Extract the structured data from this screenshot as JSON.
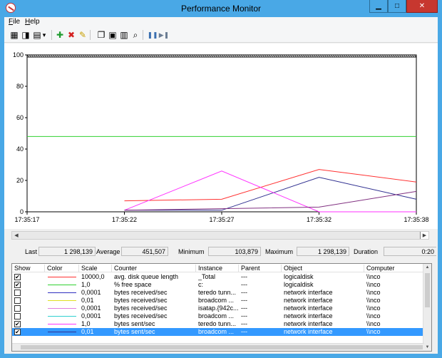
{
  "window": {
    "title": "Performance Monitor"
  },
  "menu": [
    {
      "label": "File",
      "accel": "F",
      "rest": "ile"
    },
    {
      "label": "Help",
      "accel": "H",
      "rest": "elp"
    }
  ],
  "toolbar": [
    {
      "icon": "view-graph-icon",
      "glyph": "▦"
    },
    {
      "icon": "freeze-display-icon",
      "glyph": "◨"
    },
    {
      "icon": "change-graph-type-icon",
      "glyph": "▤"
    },
    {
      "icon": "dropdown-arrow-icon",
      "glyph": "▾"
    },
    {
      "icon": "add-counter-icon",
      "glyph": "✚",
      "color": "#1e9b2e"
    },
    {
      "icon": "delete-counter-icon",
      "glyph": "✖",
      "color": "#d42020"
    },
    {
      "icon": "highlight-icon",
      "glyph": "✎",
      "color": "#c8a000"
    },
    {
      "icon": "copy-properties-icon",
      "glyph": "❐"
    },
    {
      "icon": "paste-counter-list-icon",
      "glyph": "▣"
    },
    {
      "icon": "properties-icon",
      "glyph": "▥"
    },
    {
      "icon": "zoom-icon",
      "glyph": "⌕"
    },
    {
      "icon": "freeze-icon",
      "glyph": "❚❚",
      "color": "#3a6fb0"
    },
    {
      "icon": "update-data-icon",
      "glyph": "▶❚",
      "color": "#6b7d93"
    }
  ],
  "chart_data": {
    "type": "line",
    "title": "",
    "xlabel": "",
    "ylabel": "",
    "x": [
      "17:35:17",
      "17:35:22",
      "17:35:27",
      "17:35:32",
      "17:35:38"
    ],
    "yticks": [
      0,
      20,
      40,
      60,
      80,
      100
    ],
    "ylim": [
      0,
      100
    ],
    "grid": false,
    "legend": "none",
    "series": [
      {
        "color": "#ff3030",
        "points": [
          [
            1,
            7
          ],
          [
            2,
            8
          ],
          [
            3,
            27
          ],
          [
            4,
            19
          ]
        ]
      },
      {
        "color": "#30d030",
        "points": [
          [
            0,
            48
          ],
          [
            4,
            48
          ]
        ]
      },
      {
        "color": "#303090",
        "points": [
          [
            1,
            1
          ],
          [
            2,
            1
          ],
          [
            3,
            22
          ],
          [
            4,
            8
          ]
        ]
      },
      {
        "color": "#ff30ff",
        "points": [
          [
            1,
            1
          ],
          [
            2,
            26
          ],
          [
            3,
            0
          ],
          [
            4,
            0
          ]
        ]
      },
      {
        "color": "#803080",
        "points": [
          [
            1,
            1
          ],
          [
            2,
            2
          ],
          [
            3,
            3
          ],
          [
            4,
            13
          ]
        ]
      }
    ]
  },
  "stats": {
    "last_label": "Last",
    "last_value": "1 298,139",
    "average_label": "Average",
    "average_value": "451,507",
    "minimum_label": "Minimum",
    "minimum_value": "103,879",
    "maximum_label": "Maximum",
    "maximum_value": "1 298,139",
    "duration_label": "Duration",
    "duration_value": "0:20"
  },
  "table": {
    "headers": [
      "Show",
      "Color",
      "Scale",
      "Counter",
      "Instance",
      "Parent",
      "Object",
      "Computer"
    ],
    "rows": [
      {
        "show": true,
        "color": "#ff3030",
        "scale": "10000,0",
        "counter": "avg. disk queue length",
        "instance": "_Total",
        "parent": "---",
        "object": "logicaldisk",
        "computer": "\\\\nco",
        "selected": false
      },
      {
        "show": true,
        "color": "#30d030",
        "scale": "1,0",
        "counter": "% free space",
        "instance": "c:",
        "parent": "---",
        "object": "logicaldisk",
        "computer": "\\\\nco",
        "selected": false
      },
      {
        "show": false,
        "color": "#3030c0",
        "scale": "0,0001",
        "counter": "bytes received/sec",
        "instance": "teredo tunn...",
        "parent": "---",
        "object": "network interface",
        "computer": "\\\\nco",
        "selected": false
      },
      {
        "show": false,
        "color": "#e0e020",
        "scale": "0,01",
        "counter": "bytes received/sec",
        "instance": "broadcom ...",
        "parent": "---",
        "object": "network interface",
        "computer": "\\\\nco",
        "selected": false
      },
      {
        "show": false,
        "color": "#e080e0",
        "scale": "0,0001",
        "counter": "bytes received/sec",
        "instance": "isatap.{942c...",
        "parent": "---",
        "object": "network interface",
        "computer": "\\\\nco",
        "selected": false
      },
      {
        "show": false,
        "color": "#30d0d0",
        "scale": "0,0001",
        "counter": "bytes received/sec",
        "instance": "broadcom ...",
        "parent": "---",
        "object": "network interface",
        "computer": "\\\\nco",
        "selected": false
      },
      {
        "show": true,
        "color": "#ff30ff",
        "scale": "1,0",
        "counter": "bytes sent/sec",
        "instance": "teredo tunn...",
        "parent": "---",
        "object": "network interface",
        "computer": "\\\\nco",
        "selected": false
      },
      {
        "show": true,
        "color": "#303090",
        "scale": "0,01",
        "counter": "bytes sent/sec",
        "instance": "broadcom ...",
        "parent": "---",
        "object": "network interface",
        "computer": "\\\\nco",
        "selected": true
      }
    ]
  }
}
